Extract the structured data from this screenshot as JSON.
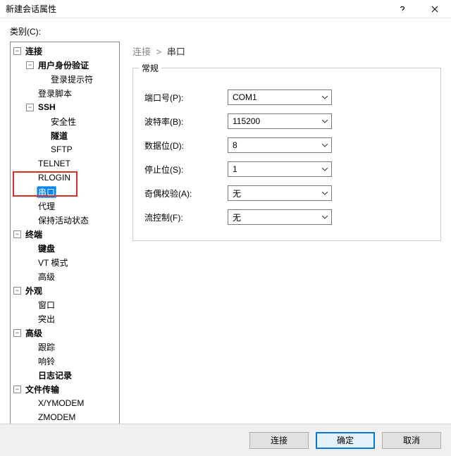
{
  "window": {
    "title": "新建会话属性"
  },
  "sidebar_label": "类别(C):",
  "tree": {
    "connection": "连接",
    "auth": "用户身份验证",
    "login_prompt": "登录提示符",
    "login_script": "登录脚本",
    "ssh": "SSH",
    "security": "安全性",
    "tunnel": "隧道",
    "sftp": "SFTP",
    "telnet": "TELNET",
    "rlogin": "RLOGIN",
    "serial": "串口",
    "proxy": "代理",
    "keepalive": "保持活动状态",
    "terminal": "终端",
    "keyboard": "键盘",
    "vt_mode": "VT 模式",
    "advanced1": "高级",
    "appearance": "外观",
    "window": "窗口",
    "highlighting": "突出",
    "advanced2": "高级",
    "trace": "跟踪",
    "bell": "响铃",
    "logging": "日志记录",
    "file_transfer": "文件传输",
    "xymodem": "X/YMODEM",
    "zmodem": "ZMODEM"
  },
  "breadcrumb": {
    "parent": "连接",
    "sep": ">",
    "current": "串口"
  },
  "group": {
    "legend": "常规",
    "rows": {
      "port": {
        "label": "端口号(P):",
        "value": "COM1"
      },
      "baud": {
        "label": "波特率(B):",
        "value": "115200"
      },
      "databits": {
        "label": "数据位(D):",
        "value": "8"
      },
      "stopbits": {
        "label": "停止位(S):",
        "value": "1"
      },
      "parity": {
        "label": "奇偶校验(A):",
        "value": "无"
      },
      "flowctrl": {
        "label": "流控制(F):",
        "value": "无"
      }
    }
  },
  "footer": {
    "connect": "连接",
    "ok": "确定",
    "cancel": "取消"
  }
}
